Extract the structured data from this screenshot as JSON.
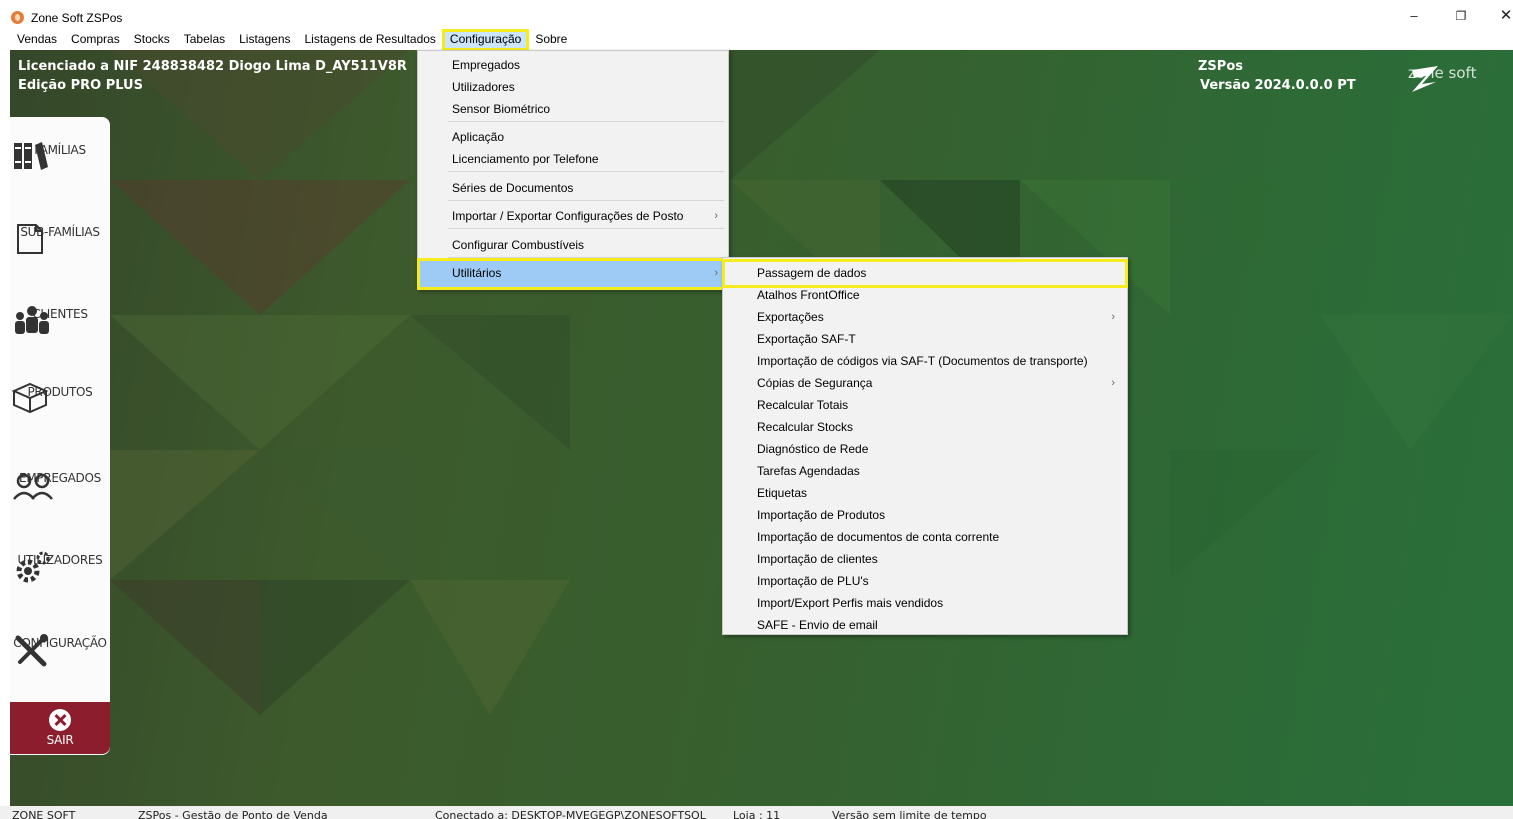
{
  "window": {
    "title": "Zone Soft ZSPos",
    "minimize": "–",
    "restore": "❐",
    "close": "✕"
  },
  "menubar": [
    "Vendas",
    "Compras",
    "Stocks",
    "Tabelas",
    "Listagens",
    "Listagens de Resultados",
    "Configuração",
    "Sobre"
  ],
  "menubar_active": "Configuração",
  "license": {
    "line1": "Licenciado a NIF 248838482 Diogo Lima D_AY511V8R",
    "line2": "Edição PRO PLUS"
  },
  "product": {
    "name": "ZSPos",
    "version": "Versão 2024.0.0.0  PT"
  },
  "brand": {
    "text": "zone soft"
  },
  "sidebar": {
    "items": [
      {
        "label": "FAMÍLIAS",
        "icon": "books-icon"
      },
      {
        "label": "SUB-FAMÍLIAS",
        "icon": "document-icon"
      },
      {
        "label": "CLIENTES",
        "icon": "people-icon"
      },
      {
        "label": "PRODUTOS",
        "icon": "box-icon"
      },
      {
        "label": "EMPREGADOS",
        "icon": "employees-icon"
      },
      {
        "label": "UTILIZADORES",
        "icon": "gears-icon"
      },
      {
        "label": "CONFIGURAÇÃO",
        "icon": "tools-icon"
      }
    ],
    "exit_label": "SAIR"
  },
  "config_menu": {
    "items": [
      "Empregados",
      "Utilizadores",
      "Sensor Biométrico",
      "Aplicação",
      "Licenciamento por Telefone",
      "Séries de Documentos",
      "Importar / Exportar Configurações de Posto",
      "Configurar Combustíveis",
      "Utilitários"
    ],
    "arrow": "›"
  },
  "util_menu": {
    "items": [
      "Passagem de dados",
      "Atalhos FrontOffice",
      "Exportações",
      "Exportação SAF-T",
      "Importação de códigos via SAF-T (Documentos de transporte)",
      "Cópias de Segurança",
      "Recalcular Totais",
      "Recalcular Stocks",
      "Diagnóstico de Rede",
      "Tarefas Agendadas",
      "Etiquetas",
      "Importação de Produtos",
      "Importação de documentos de conta corrente",
      "Importação de clientes",
      "Importação de PLU's",
      "Import/Export Perfis mais vendidos",
      "SAFE - Envio de email"
    ]
  },
  "statusbar": {
    "company": "ZONE SOFT",
    "app": "ZSPos - Gestão de Ponto de Venda",
    "connection": "Conectado a: DESKTOP-MVEGEGP\\ZONESOFTSQL",
    "store": "Loja : 11",
    "license": "Versão sem limite de tempo"
  },
  "colors": {
    "highlight_outline": "#f6ec1d",
    "menu_selected": "#9ecbf5",
    "exit_button": "#8c1d2d"
  }
}
